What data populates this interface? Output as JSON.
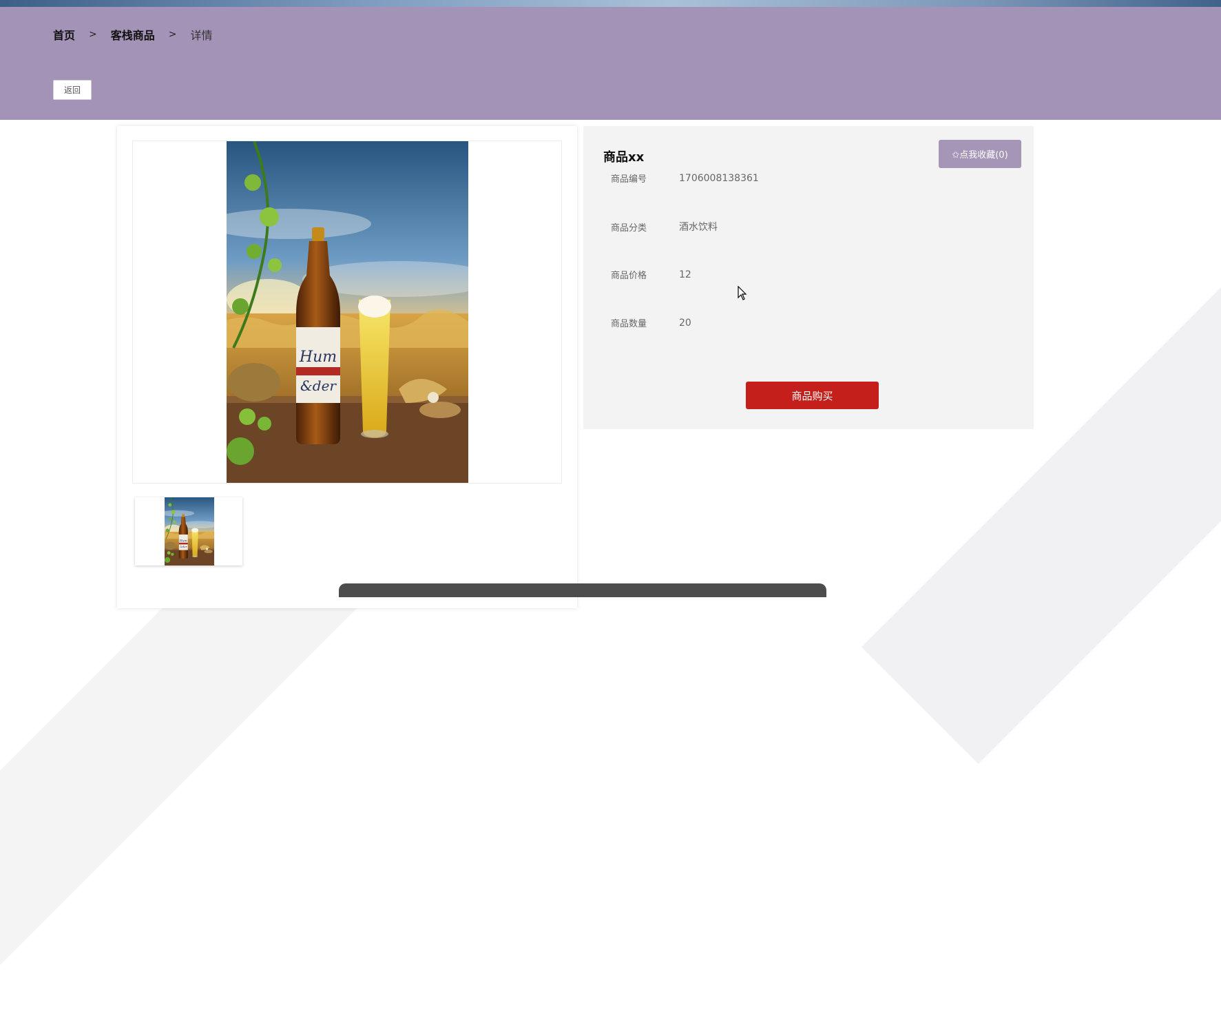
{
  "breadcrumb": {
    "home": "首页",
    "sep1": ">",
    "category": "客栈商品",
    "sep2": ">",
    "current": "详情"
  },
  "header": {
    "back_label": "返回"
  },
  "product": {
    "title": "商品xx",
    "favorite_label": "✩点我收藏(0)",
    "fields": [
      {
        "label": "商品编号",
        "value": "1706008138361"
      },
      {
        "label": "商品分类",
        "value": "酒水饮料"
      },
      {
        "label": "商品价格",
        "value": "12"
      },
      {
        "label": "商品数量",
        "value": "20"
      }
    ],
    "buy_label": "商品购买"
  },
  "colors": {
    "header_bg": "#a393b6",
    "accent": "#a596b7",
    "buy_button": "#c41f1a",
    "panel_bg": "#f3f3f3"
  },
  "icons": {
    "cursor": "mouse-pointer-icon",
    "favorite": "star-outline-icon"
  }
}
